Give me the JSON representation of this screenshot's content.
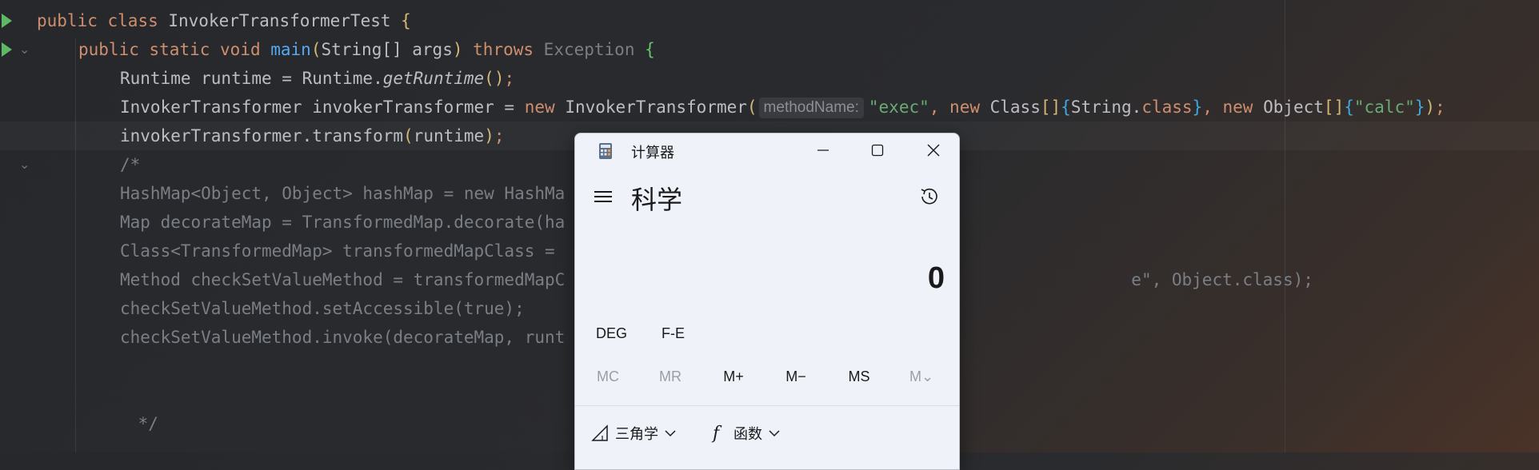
{
  "editor": {
    "lines": [
      {
        "parts": [
          [
            "kw",
            "public "
          ],
          [
            "kw",
            "class "
          ],
          [
            "",
            "InvokerTransformerTest "
          ],
          [
            "br1",
            "{"
          ]
        ]
      },
      {
        "parts": [
          [
            "kw",
            "public "
          ],
          [
            "kw",
            "static "
          ],
          [
            "kw",
            "void "
          ],
          [
            "fn",
            "main"
          ],
          [
            "br1",
            "("
          ],
          [
            "",
            "String[] args"
          ],
          [
            "br1",
            ")"
          ],
          [
            "kw",
            " throws "
          ],
          [
            "gr",
            "Exception "
          ],
          [
            "br3",
            "{"
          ]
        ]
      },
      {
        "parts": [
          [
            "",
            "Runtime runtime = Runtime."
          ],
          [
            "it",
            "getRuntime"
          ],
          [
            "br1",
            "()"
          ],
          [
            "kw",
            ";"
          ]
        ]
      },
      {
        "parts": [
          [
            "",
            "InvokerTransformer invokerTransformer = "
          ],
          [
            "kw",
            "new "
          ],
          [
            "",
            "InvokerTransformer"
          ],
          [
            "br1",
            "("
          ],
          [
            "hint",
            "methodName:"
          ],
          [
            "str",
            "\"exec\""
          ],
          [
            "kw",
            ", "
          ],
          [
            "kw",
            "new "
          ],
          [
            "",
            "Class"
          ],
          [
            "br1",
            "[]"
          ],
          [
            "br2",
            "{"
          ],
          [
            "",
            "String."
          ],
          [
            "kw",
            "class"
          ],
          [
            "br2",
            "}"
          ],
          [
            "kw",
            ", "
          ],
          [
            "kw",
            "new "
          ],
          [
            "",
            "Object"
          ],
          [
            "br1",
            "[]"
          ],
          [
            "br2",
            "{"
          ],
          [
            "str",
            "\"calc\""
          ],
          [
            "br2",
            "}"
          ],
          [
            "br1",
            ")"
          ],
          [
            "kw",
            ";"
          ]
        ]
      },
      {
        "parts": [
          [
            "",
            "invokerTransformer.transform"
          ],
          [
            "br1",
            "("
          ],
          [
            "",
            "runtime"
          ],
          [
            "br1",
            ")"
          ],
          [
            "kw",
            ";"
          ]
        ]
      },
      {
        "parts": [
          [
            "comment",
            "/*"
          ]
        ]
      },
      {
        "parts": [
          [
            "comment",
            "HashMap<Object, Object> hashMap = new HashMa"
          ]
        ]
      },
      {
        "parts": [
          [
            "comment",
            "Map decorateMap = TransformedMap.decorate(ha"
          ]
        ]
      },
      {
        "parts": [
          [
            "comment",
            "Class<TransformedMap> transformedMapClass = "
          ]
        ]
      },
      {
        "parts": [
          [
            "comment",
            "Method checkSetValueMethod = transformedMapC"
          ],
          [
            "comment",
            "                                                        e\", Object.class);"
          ]
        ]
      },
      {
        "parts": [
          [
            "comment",
            "checkSetValueMethod.setAccessible(true);"
          ]
        ]
      },
      {
        "parts": [
          [
            "comment",
            "checkSetValueMethod.invoke(decorateMap, runt"
          ]
        ]
      },
      {
        "parts": [
          [
            "comment",
            ""
          ]
        ]
      },
      {
        "parts": [
          [
            "comment",
            ""
          ]
        ]
      },
      {
        "parts": [
          [
            "comment",
            " */"
          ]
        ]
      }
    ]
  },
  "calculator": {
    "window_title": "计算器",
    "mode_title": "科学",
    "display_value": "0",
    "angle_mode": "DEG",
    "fe_label": "F-E",
    "memory_buttons": [
      "MC",
      "MR",
      "M+",
      "M−",
      "MS",
      "M⌄"
    ],
    "trig_label": "三角学",
    "func_label": "函数",
    "colors": {
      "background": "#eff3f9",
      "accent": "#1a1a1a"
    }
  }
}
